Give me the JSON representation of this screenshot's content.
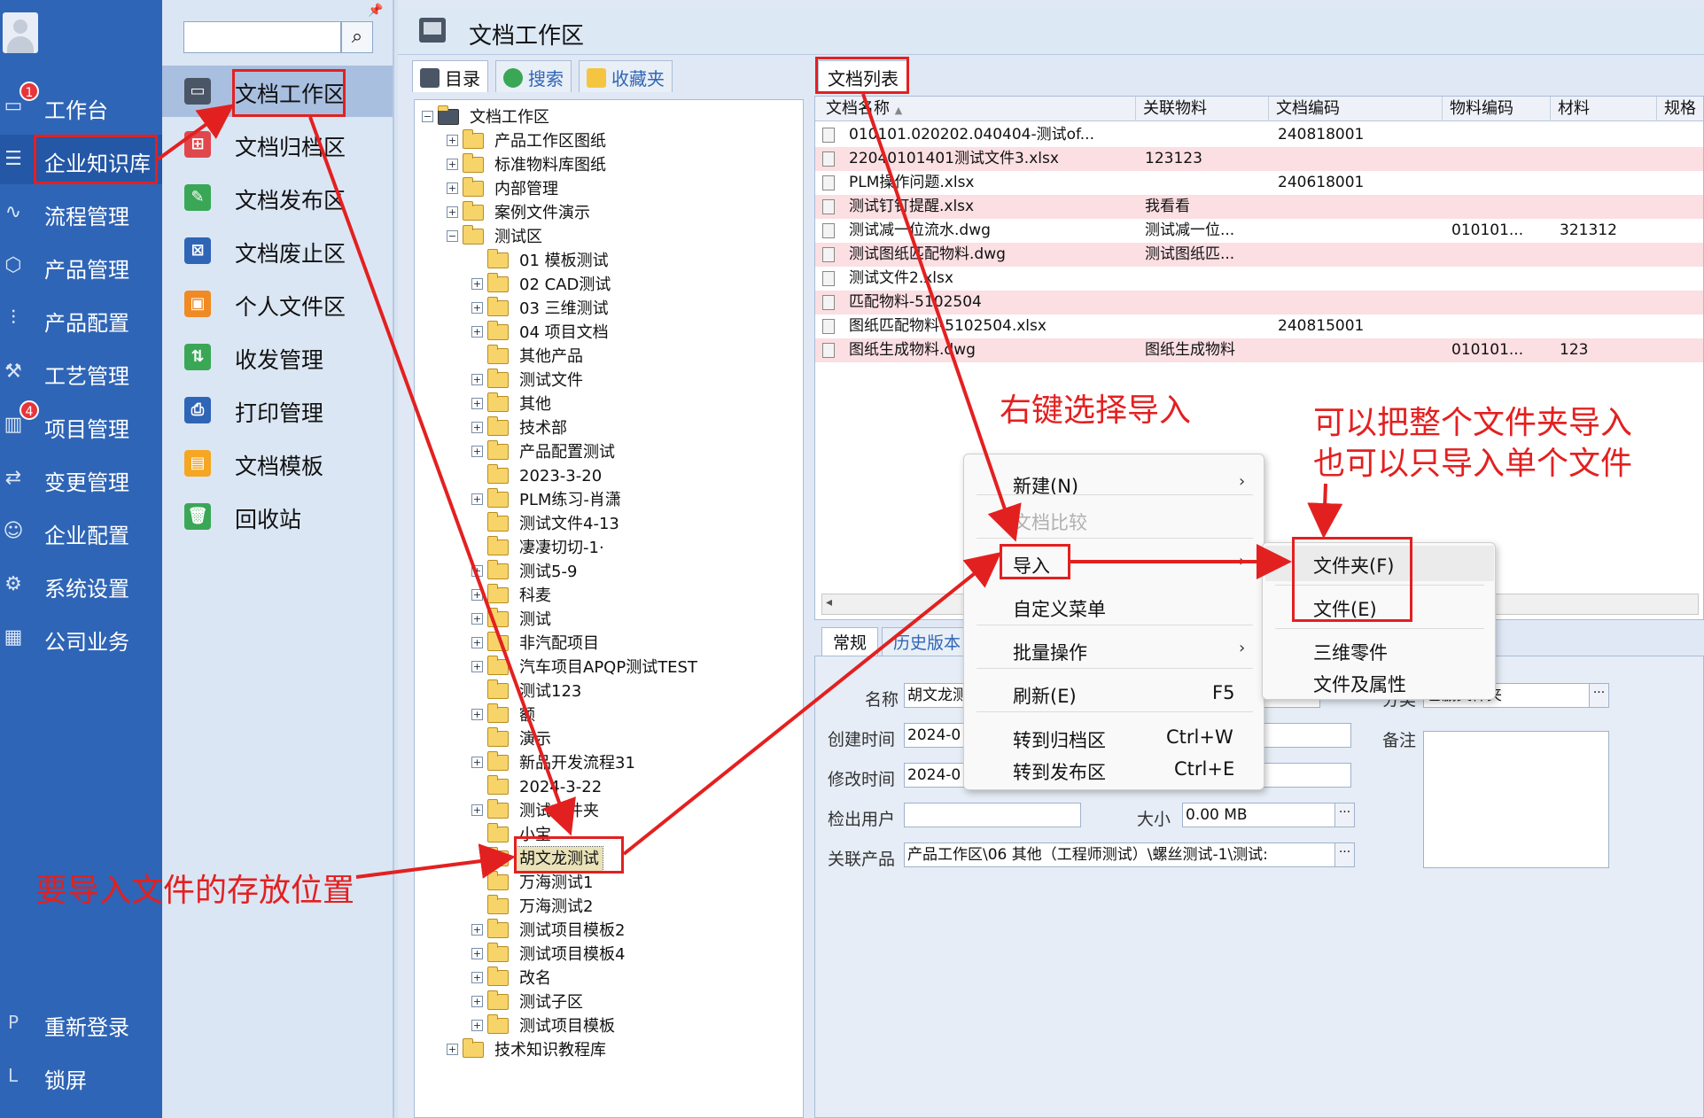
{
  "colors": {
    "nav_bg": "#2f65b6",
    "accent_red": "#e32020",
    "row_pink": "#fbdfe3"
  },
  "leftnav": {
    "items": [
      {
        "label": "工作台",
        "icon": "monitor-icon",
        "badge": "1"
      },
      {
        "label": "企业知识库",
        "icon": "list-icon",
        "badge": ""
      },
      {
        "label": "流程管理",
        "icon": "flow-icon",
        "badge": ""
      },
      {
        "label": "产品管理",
        "icon": "cube-icon",
        "badge": ""
      },
      {
        "label": "产品配置",
        "icon": "sliders-icon",
        "badge": ""
      },
      {
        "label": "工艺管理",
        "icon": "wrench-icon",
        "badge": ""
      },
      {
        "label": "项目管理",
        "icon": "chart-icon",
        "badge": "4"
      },
      {
        "label": "变更管理",
        "icon": "change-icon",
        "badge": ""
      },
      {
        "label": "企业配置",
        "icon": "users-icon",
        "badge": ""
      },
      {
        "label": "系统设置",
        "icon": "gear-icon",
        "badge": ""
      },
      {
        "label": "公司业务",
        "icon": "grid-icon",
        "badge": ""
      }
    ],
    "bottom": [
      {
        "key": "P",
        "label": "重新登录"
      },
      {
        "key": "L",
        "label": "锁屏"
      }
    ]
  },
  "subnav": {
    "search_placeholder": "",
    "items": [
      {
        "label": "文档工作区",
        "icon": "monitor-icon",
        "color": "#4a5566"
      },
      {
        "label": "文档归档区",
        "icon": "archive-icon",
        "color": "#e0474c"
      },
      {
        "label": "文档发布区",
        "icon": "publish-icon",
        "color": "#3aa757"
      },
      {
        "label": "文档废止区",
        "icon": "void-icon",
        "color": "#2f65b6"
      },
      {
        "label": "个人文件区",
        "icon": "personal-icon",
        "color": "#f08a24"
      },
      {
        "label": "收发管理",
        "icon": "transfer-icon",
        "color": "#3aa757"
      },
      {
        "label": "打印管理",
        "icon": "printer-icon",
        "color": "#2f65b6"
      },
      {
        "label": "文档模板",
        "icon": "template-icon",
        "color": "#f5a623"
      },
      {
        "label": "回收站",
        "icon": "trash-icon",
        "color": "#3aa757"
      }
    ]
  },
  "window": {
    "title": "文档工作区"
  },
  "treepanel": {
    "tabs": [
      {
        "label": "目录",
        "icon": "directory-icon"
      },
      {
        "label": "搜索",
        "icon": "search-icon"
      },
      {
        "label": "收藏夹",
        "icon": "favorites-icon"
      }
    ],
    "root": "文档工作区",
    "nodes": [
      {
        "label": "产品工作区图纸",
        "level": 1,
        "exp": "+"
      },
      {
        "label": "标准物料库图纸",
        "level": 1,
        "exp": "+"
      },
      {
        "label": "内部管理",
        "level": 1,
        "exp": "+"
      },
      {
        "label": "案例文件演示",
        "level": 1,
        "exp": "+"
      },
      {
        "label": "测试区",
        "level": 1,
        "exp": "-"
      },
      {
        "label": "01 模板测试",
        "level": 2,
        "exp": ""
      },
      {
        "label": "02 CAD测试",
        "level": 2,
        "exp": "+"
      },
      {
        "label": "03 三维测试",
        "level": 2,
        "exp": "+"
      },
      {
        "label": "04 项目文档",
        "level": 2,
        "exp": "+"
      },
      {
        "label": "其他产品",
        "level": 2,
        "exp": ""
      },
      {
        "label": "测试文件",
        "level": 2,
        "exp": "+"
      },
      {
        "label": "其他",
        "level": 2,
        "exp": "+"
      },
      {
        "label": "技术部",
        "level": 2,
        "exp": "+"
      },
      {
        "label": "产品配置测试",
        "level": 2,
        "exp": "+"
      },
      {
        "label": "2023-3-20",
        "level": 2,
        "exp": ""
      },
      {
        "label": "PLM练习-肖潇",
        "level": 2,
        "exp": "+"
      },
      {
        "label": "测试文件4-13",
        "level": 2,
        "exp": ""
      },
      {
        "label": "凄凄切切-1·",
        "level": 2,
        "exp": ""
      },
      {
        "label": "测试5-9",
        "level": 2,
        "exp": "+"
      },
      {
        "label": "科麦",
        "level": 2,
        "exp": "+"
      },
      {
        "label": "测试",
        "level": 2,
        "exp": "+"
      },
      {
        "label": "非汽配项目",
        "level": 2,
        "exp": "+"
      },
      {
        "label": "汽车项目APQP测试TEST",
        "level": 2,
        "exp": "+"
      },
      {
        "label": "测试123",
        "level": 2,
        "exp": ""
      },
      {
        "label": "额",
        "level": 2,
        "exp": "+"
      },
      {
        "label": "演示",
        "level": 2,
        "exp": ""
      },
      {
        "label": "新品开发流程31",
        "level": 2,
        "exp": "+"
      },
      {
        "label": "2024-3-22",
        "level": 2,
        "exp": ""
      },
      {
        "label": "测试文件夹",
        "level": 2,
        "exp": "+"
      },
      {
        "label": "小宝",
        "level": 2,
        "exp": ""
      },
      {
        "label": "胡文龙测试",
        "level": 2,
        "exp": "",
        "selected": true
      },
      {
        "label": "万海测试1",
        "level": 2,
        "exp": ""
      },
      {
        "label": "万海测试2",
        "level": 2,
        "exp": ""
      },
      {
        "label": "测试项目模板2",
        "level": 2,
        "exp": "+"
      },
      {
        "label": "测试项目模板4",
        "level": 2,
        "exp": "+"
      },
      {
        "label": "改名",
        "level": 2,
        "exp": "+"
      },
      {
        "label": "测试子区",
        "level": 2,
        "exp": "+"
      },
      {
        "label": "测试项目模板",
        "level": 2,
        "exp": "+"
      },
      {
        "label": "技术知识教程库",
        "level": 1,
        "exp": "+"
      }
    ]
  },
  "listpanel": {
    "tab": "文档列表",
    "columns": [
      "文档名称",
      "关联物料",
      "文档编码",
      "物料编码",
      "材料",
      "规格"
    ],
    "rows": [
      [
        "010101.020202.040404-测试of...",
        "",
        "240818001",
        "",
        "",
        ""
      ],
      [
        "22040101401测试文件3.xlsx",
        "123123",
        "",
        "",
        "",
        ""
      ],
      [
        "PLM操作问题.xlsx",
        "",
        "240618001",
        "",
        "",
        ""
      ],
      [
        "测试钉钉提醒.xlsx",
        "我看看",
        "",
        "",
        "",
        ""
      ],
      [
        "测试减一位流水.dwg",
        "测试减一位...",
        "",
        "010101...",
        "321312",
        ""
      ],
      [
        "测试图纸匹配物料.dwg",
        "测试图纸匹...",
        "",
        "",
        "",
        ""
      ],
      [
        "测试文件2.xlsx",
        "",
        "",
        "",
        "",
        ""
      ],
      [
        "匹配物料-5102504",
        "",
        "",
        "",
        "",
        ""
      ],
      [
        "图纸匹配物料-5102504.xlsx",
        "",
        "240815001",
        "",
        "",
        ""
      ],
      [
        "图纸生成物料.dwg",
        "图纸生成物料",
        "",
        "010101...",
        "123",
        ""
      ]
    ]
  },
  "proppanel": {
    "tabs": [
      "常规",
      "历史版本"
    ],
    "labels": {
      "name": "名称",
      "created": "创建时间",
      "modified": "修改时间",
      "checkout_user": "检出用户",
      "size": "大小",
      "linked_product": "关联产品",
      "category": "分类",
      "remark": "备注"
    },
    "values": {
      "name": "胡文龙测",
      "created": "2024-0",
      "modified": "2024-0",
      "checkout_user": "",
      "size": "0.00 MB",
      "linked_product": "产品工作区\\06 其他（工程师测试）\\螺丝测试-1\\测试:",
      "category": "已删文件夹",
      "remark": ""
    }
  },
  "contextmenu": {
    "items": [
      {
        "label": "新建(N)",
        "shortcut": "",
        "submenu": true,
        "disabled": false
      },
      {
        "label": "文档比较",
        "shortcut": "",
        "submenu": false,
        "disabled": true
      },
      {
        "label": "导入",
        "shortcut": "",
        "submenu": true,
        "disabled": false
      },
      {
        "label": "自定义菜单",
        "shortcut": "",
        "submenu": false,
        "disabled": false
      },
      {
        "label": "批量操作",
        "shortcut": "",
        "submenu": true,
        "disabled": false
      },
      {
        "label": "刷新(E)",
        "shortcut": "F5",
        "submenu": false,
        "disabled": false
      },
      {
        "label": "转到归档区",
        "shortcut": "Ctrl+W",
        "submenu": false,
        "disabled": false
      },
      {
        "label": "转到发布区",
        "shortcut": "Ctrl+E",
        "submenu": false,
        "disabled": false
      }
    ],
    "submenu": [
      "文件夹(F)",
      "文件(E)",
      "三维零件",
      "文件及属性"
    ]
  },
  "annotations": {
    "right_click": "右键选择导入",
    "folder_or_file_1": "可以把整个文件夹导入",
    "folder_or_file_2": "也可以只导入单个文件",
    "location": "要导入文件的存放位置"
  }
}
